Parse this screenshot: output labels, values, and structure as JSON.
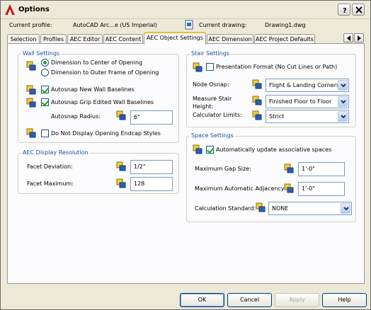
{
  "window": {
    "title": "Options"
  },
  "profile": {
    "current_profile_label": "Current profile:",
    "current_profile_value": "AutoCAD Arc...e (US Imperial)",
    "current_drawing_label": "Current drawing:",
    "current_drawing_value": "Drawing1.dwg"
  },
  "tabs": [
    {
      "label": "Selection"
    },
    {
      "label": "Profiles"
    },
    {
      "label": "AEC Editor"
    },
    {
      "label": "AEC Content"
    },
    {
      "label": "AEC Object Settings",
      "active": true
    },
    {
      "label": "AEC Dimension"
    },
    {
      "label": "AEC Project Defaults"
    }
  ],
  "wall_settings": {
    "title": "Wall Settings",
    "radio_center": "Dimension to Center of Opening",
    "radio_outer": "Dimension to Outer Frame of Opening",
    "autosnap_new": "Autosnap New Wall Baselines",
    "autosnap_grip": "Autosnap Grip Edited Wall Baselines",
    "autosnap_radius_label": "Autosnap Radius:",
    "autosnap_radius_value": "6\"",
    "no_endcap": "Do Not Display Opening Endcap Styles"
  },
  "display_resolution": {
    "title": "AEC Display Resolution",
    "facet_deviation_label": "Facet Deviation:",
    "facet_deviation_value": "1/2\"",
    "facet_maximum_label": "Facet Maximum:",
    "facet_maximum_value": "128"
  },
  "stair_settings": {
    "title": "Stair Settings",
    "presentation_format": "Presentation Format (No Cut Lines or Path)",
    "node_osnap_label": "Node Osnap:",
    "node_osnap_value": "Flight & Landing Corners",
    "measure_height_label_1": "Measure Stair",
    "measure_height_label_2": "Height:",
    "measure_height_value": "Finished Floor to Floor",
    "calculator_limits_label": "Calculator Limits:",
    "calculator_limits_value": "Strict"
  },
  "space_settings": {
    "title": "Space Settings",
    "auto_update": "Automatically update associative spaces",
    "max_gap_label": "Maximum Gap Size:",
    "max_gap_value": "1'-0\"",
    "max_adjacency_label": "Maximum Automatic Adjacency",
    "max_adjacency_value": "1'-0\"",
    "calc_standard_label": "Calculation Standard:",
    "calc_standard_value": "NONE"
  },
  "buttons": {
    "ok": "OK",
    "cancel": "Cancel",
    "apply": "Apply",
    "help": "Help"
  }
}
